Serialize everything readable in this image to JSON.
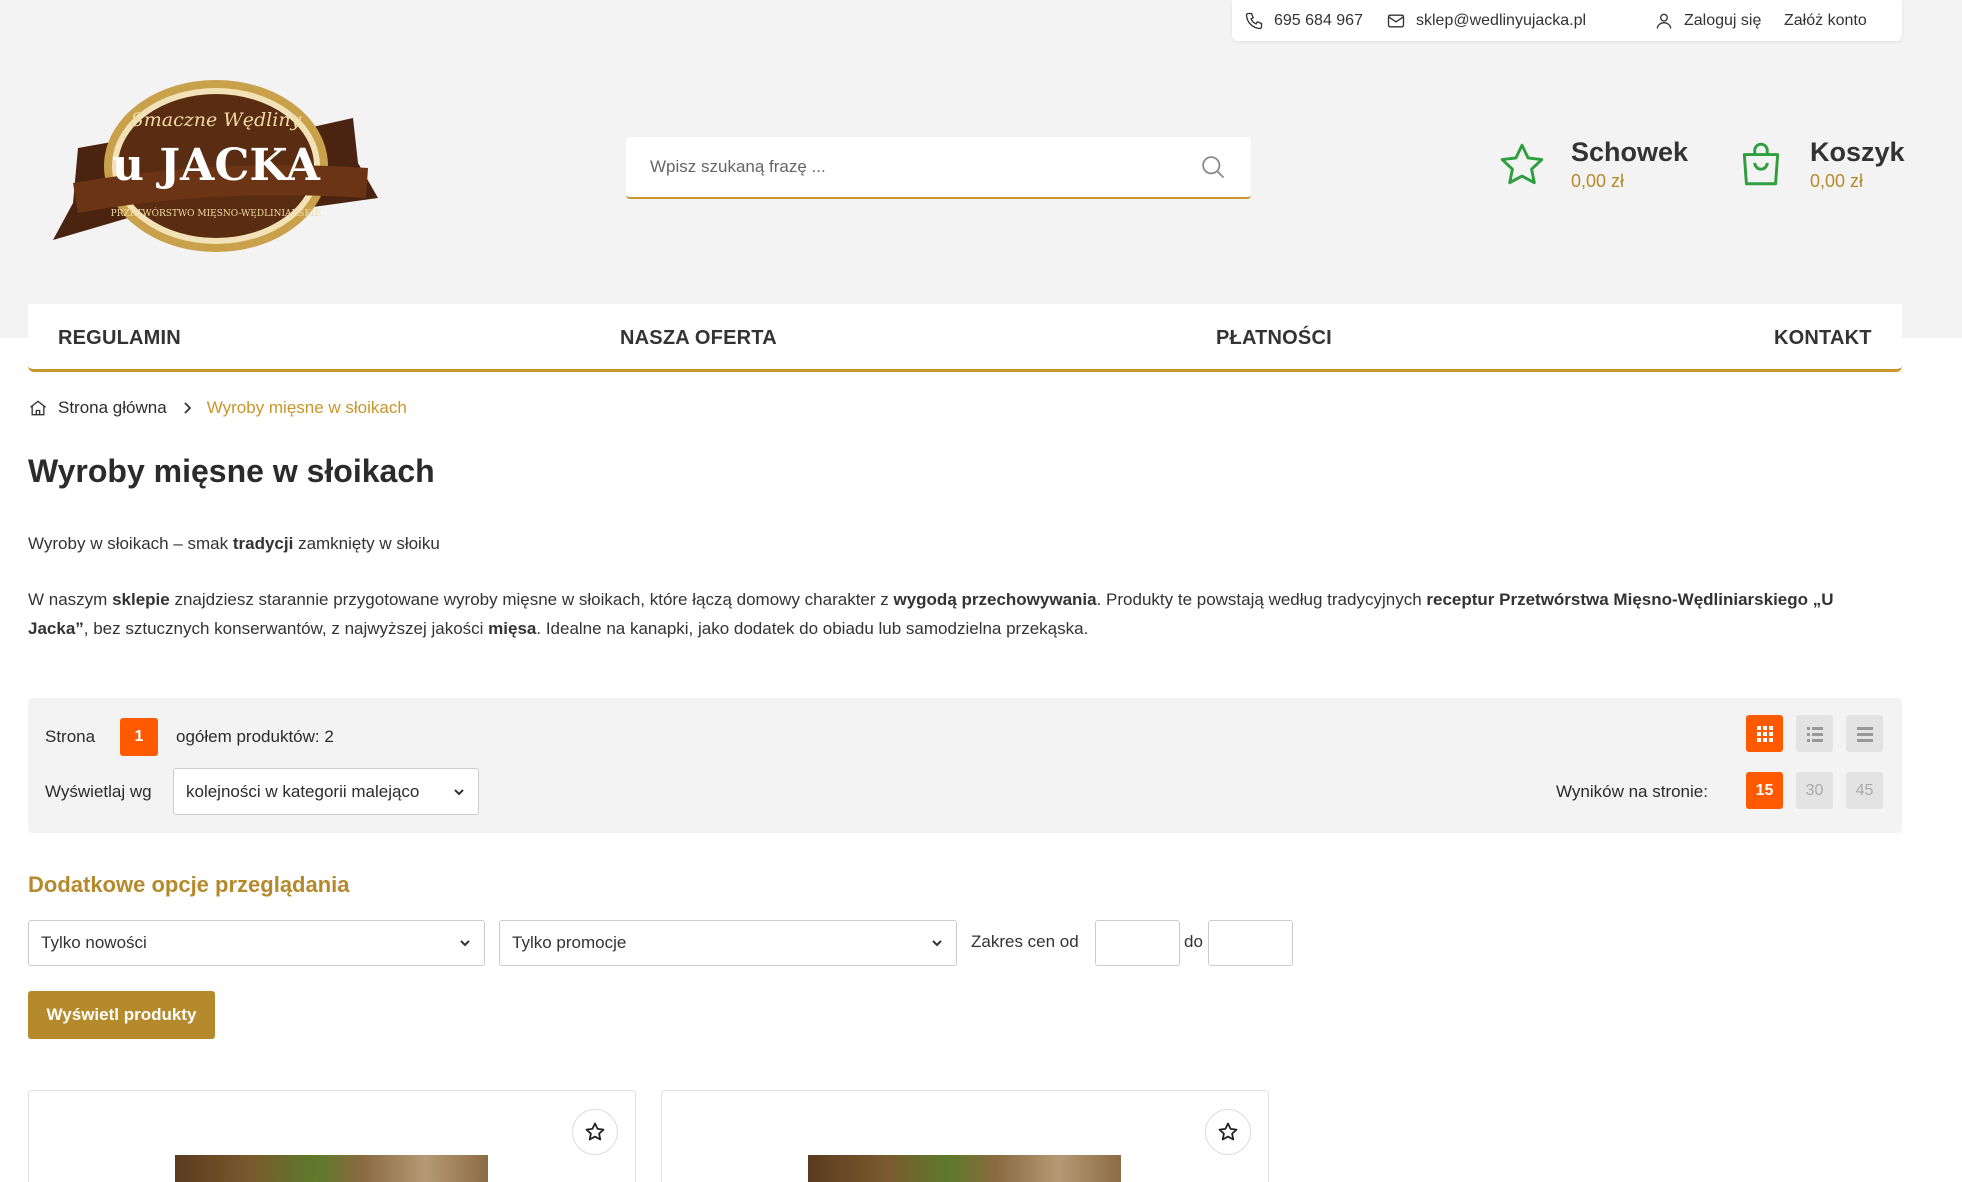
{
  "topbar": {
    "phone": "695 684 967",
    "email": "sklep@wedlinyujacka.pl",
    "login": "Zaloguj się",
    "register": "Załóż konto"
  },
  "logo": {
    "line1": "Smaczne Wędliny",
    "line2": "u JACKA",
    "line3": "PRZETWÓRSTWO MIĘSNO-WĘDLINIARSKIE"
  },
  "search": {
    "placeholder": "Wpisz szukaną frazę ..."
  },
  "wishlist": {
    "title": "Schowek",
    "amount": "0,00 zł"
  },
  "cart": {
    "title": "Koszyk",
    "amount": "0,00 zł"
  },
  "menu": {
    "items": [
      {
        "label": "REGULAMIN"
      },
      {
        "label": "NASZA OFERTA"
      },
      {
        "label": "PŁATNOŚCI"
      },
      {
        "label": "KONTAKT"
      }
    ]
  },
  "breadcrumb": {
    "home": "Strona główna",
    "current": "Wyroby mięsne w słoikach"
  },
  "page_title": "Wyroby mięsne w słoikach",
  "description": {
    "p1": {
      "a": "Wyroby w słoikach – smak ",
      "b": "tradycji",
      "c": " zamknięty w słoiku"
    },
    "p2": {
      "a": "W naszym ",
      "b": "sklepie",
      "c": " znajdziesz starannie przygotowane wyroby mięsne w słoikach, które łączą domowy charakter z ",
      "d": "wygodą przechowywania",
      "e": ". Produkty te powstają według tradycyjnych ",
      "f": "receptur Przetwórstwa Mięsno-Wędliniarskiego „U Jacka”",
      "g": ", bez sztucznych konserwantów, z najwyższej jakości ",
      "h": "mięsa",
      "i": ". Idealne na kanapki, jako dodatek do obiadu lub samodzielna przekąska."
    }
  },
  "toolbar": {
    "page_label": "Strona",
    "page_number": "1",
    "total_label": "ogółem produktów: 2",
    "sort_label": "Wyświetlaj wg",
    "sort_value": "kolejności w kategorii malejąco",
    "per_page_label": "Wyników na stronie:",
    "per_page_options": [
      "15",
      "30",
      "45"
    ],
    "per_page_selected": "15",
    "view_modes": [
      "grid-view-icon",
      "list-view-icon",
      "compact-list-icon"
    ],
    "view_selected": "grid"
  },
  "extra": {
    "title": "Dodatkowe opcje przeglądania",
    "new_only": "Tylko nowości",
    "promo_only": "Tylko promocje",
    "price_from": "Zakres cen od",
    "price_to": "do",
    "show_button": "Wyświetl produkty"
  },
  "colors": {
    "accent_gold": "#c8962c",
    "accent_orange": "#ff5a00",
    "icon_green": "#2e9e3e",
    "header_bg": "#f3f3f3"
  }
}
